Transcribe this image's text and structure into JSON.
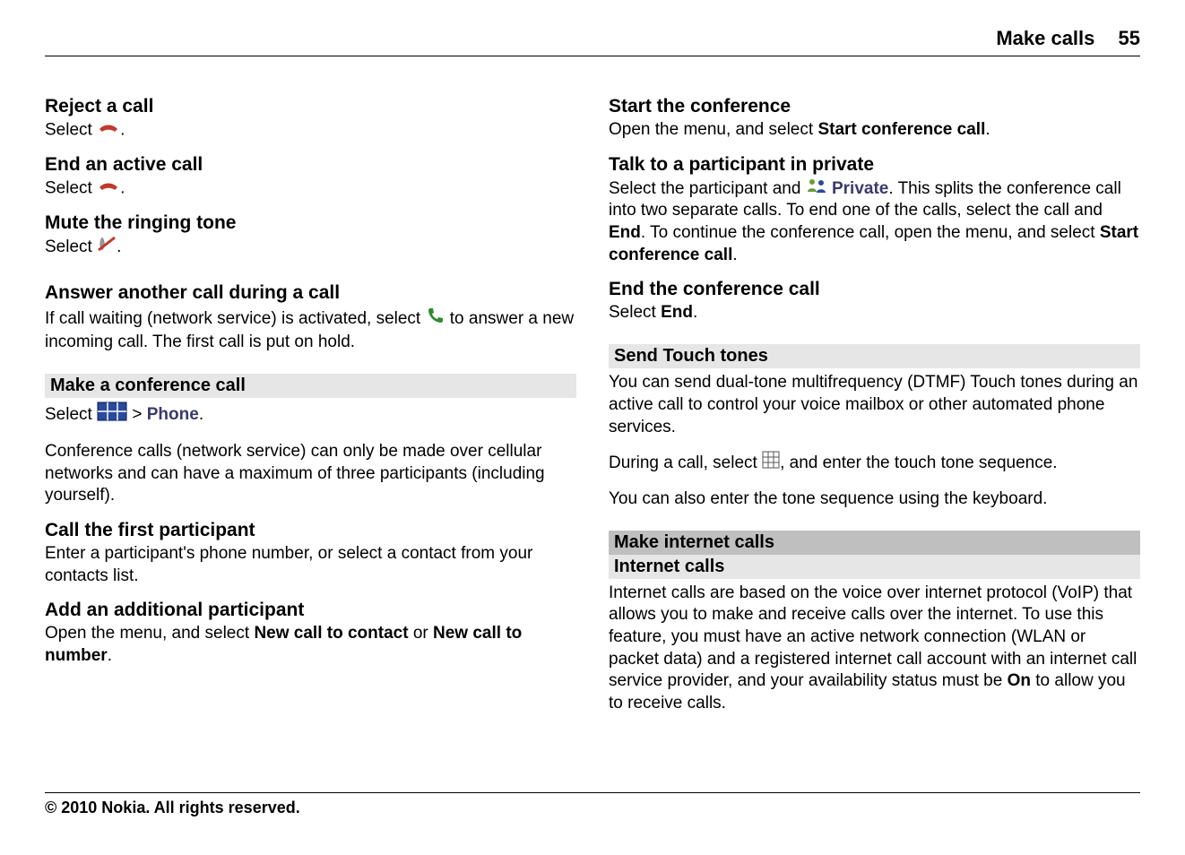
{
  "header": {
    "section": "Make calls",
    "page": "55"
  },
  "left": {
    "reject_h": "Reject a call",
    "reject_p1": "Select ",
    "reject_p2": ".",
    "end_h": "End an active call",
    "end_p1": "Select ",
    "end_p2": ".",
    "mute_h": "Mute the ringing tone",
    "mute_p1": "Select ",
    "mute_p2": ".",
    "answer_h": "Answer another call during a call",
    "answer_p1": "If call waiting (network service) is activated, select ",
    "answer_p2": " to answer a new incoming call. The first call is put on hold.",
    "conf_sect": "Make a conference call",
    "conf_open1": "Select ",
    "conf_open2": " > ",
    "conf_open_phone": "Phone",
    "conf_open3": ".",
    "conf_desc": "Conference calls (network service) can only be made over cellular networks and can have a maximum of three participants (including yourself).",
    "callfirst_h": "Call the first participant",
    "callfirst_p": "Enter a participant's phone number, or select a contact from your contacts list.",
    "add_h": "Add an additional participant",
    "add_p1": "Open the menu, and select ",
    "add_p2": "New call to contact",
    "add_p3": " or ",
    "add_p4": "New call to number",
    "add_p5": "."
  },
  "right": {
    "start_h": "Start the conference",
    "start_p1": "Open the menu, and select ",
    "start_p2": "Start conference call",
    "start_p3": ".",
    "talk_h": "Talk to a participant in private",
    "talk_p1": "Select the participant and ",
    "talk_private": "Private",
    "talk_p2": ". This splits the conference call into two separate calls. To end one of the calls, select the call and ",
    "talk_end": "End",
    "talk_p3": ". To continue the conference call, open the menu, and select ",
    "talk_start": "Start conference call",
    "talk_p4": ".",
    "endconf_h": "End the conference call",
    "endconf_p1": "Select ",
    "endconf_end": "End",
    "endconf_p2": ".",
    "sendtt_sect": "Send Touch tones",
    "sendtt_p1": "You can send dual-tone multifrequency (DTMF) Touch tones during an active call to control your voice mailbox or other automated phone services.",
    "sendtt_p2a": "During a call, select ",
    "sendtt_p2b": ", and enter the touch tone sequence.",
    "sendtt_p3": "You can also enter the tone sequence using the keyboard.",
    "inet_sect_dark": "Make internet calls",
    "inet_sect": "Internet calls",
    "inet_p1": "Internet calls are based on the voice over internet protocol (VoIP) that allows you to make and receive calls over the internet. To use this feature, you must have an active network connection (WLAN or packet data) and a registered internet call account with an internet call service provider, and your availability status must be ",
    "inet_on": "On",
    "inet_p2": " to allow you to receive calls."
  },
  "footer": "© 2010 Nokia. All rights reserved."
}
